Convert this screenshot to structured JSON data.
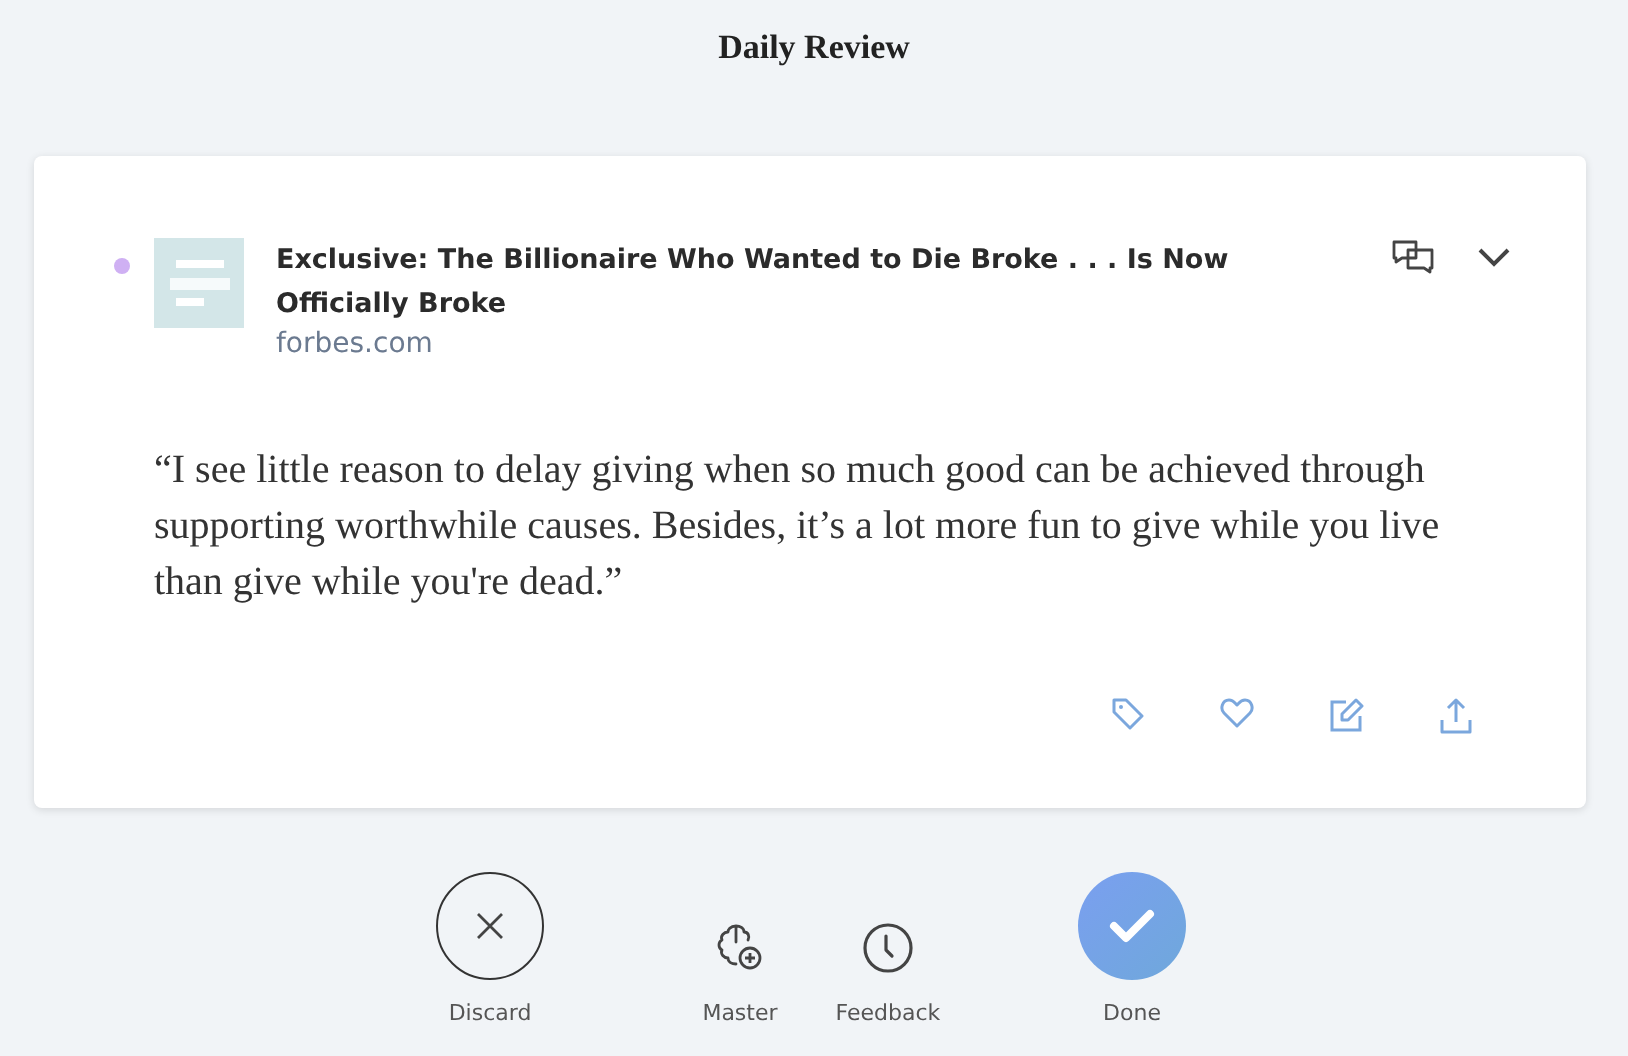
{
  "header": {
    "title": "Daily Review"
  },
  "card": {
    "dot": {
      "color": "#cfb0f3"
    },
    "title": "Exclusive: The Billionaire Who Wanted to Die Broke . . . Is Now Officially Broke",
    "source": "forbes.com",
    "quote": "“I see little reason to delay giving when so much good can be achieved through supporting worthwhile causes. Besides, it’s a lot more fun to give while you live than give while you're dead.”"
  },
  "actions": [
    {
      "kind": "discard",
      "label": "Discard"
    },
    {
      "kind": "master",
      "label": "Master"
    },
    {
      "kind": "feedback",
      "label": "Feedback"
    },
    {
      "kind": "done",
      "label": "Done"
    }
  ]
}
